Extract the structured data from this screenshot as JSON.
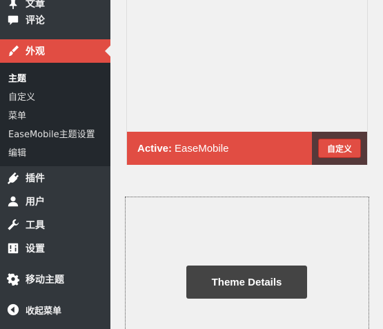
{
  "sidebar": {
    "items": [
      {
        "label": "文章",
        "icon": "pushpin-icon"
      },
      {
        "label": "评论",
        "icon": "comment-icon"
      },
      {
        "label": "外观",
        "icon": "paintbrush-icon",
        "active": true
      },
      {
        "label": "插件",
        "icon": "plugin-icon"
      },
      {
        "label": "用户",
        "icon": "user-icon"
      },
      {
        "label": "工具",
        "icon": "wrench-icon"
      },
      {
        "label": "设置",
        "icon": "settings-icon"
      },
      {
        "label": "移动主题",
        "icon": "gear-icon"
      },
      {
        "label": "收起菜单",
        "icon": "collapse-arrow-icon"
      }
    ],
    "submenu": [
      {
        "label": "主题",
        "current": true
      },
      {
        "label": "自定义"
      },
      {
        "label": "菜单"
      },
      {
        "label": "EaseMobile主题设置"
      },
      {
        "label": "编辑"
      }
    ]
  },
  "active_theme": {
    "active_label": "Active:",
    "theme_name": "EaseMobile",
    "customize_label": "自定义"
  },
  "theme_card_2": {
    "details_label": "Theme Details"
  },
  "colors": {
    "sidebar_bg": "#32373c",
    "submenu_bg": "#23282d",
    "accent_red": "#e14d43",
    "details_button": "#444444"
  }
}
